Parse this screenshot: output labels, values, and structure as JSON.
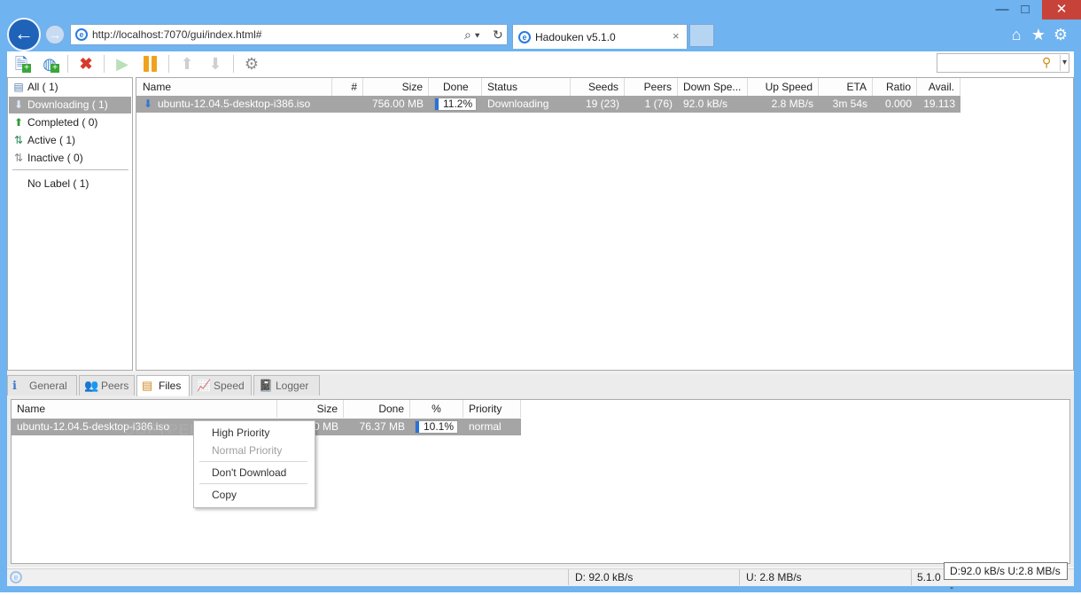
{
  "browser": {
    "address": "http://localhost:7070/gui/index.html#",
    "tab_title": "Hadouken v5.1.0",
    "tab_close": "×",
    "window_controls": {
      "minimize": "—",
      "maximize": "□",
      "close": "✕"
    }
  },
  "filters": {
    "items": [
      {
        "icon": "all-icon",
        "label": "All ( 1)"
      },
      {
        "icon": "download-arrow-icon",
        "label": "Downloading ( 1)"
      },
      {
        "icon": "upload-arrow-icon",
        "label": "Completed ( 0)"
      },
      {
        "icon": "active-arrows-icon",
        "label": "Active ( 1)"
      },
      {
        "icon": "inactive-arrows-icon",
        "label": "Inactive ( 0)"
      }
    ],
    "labels": [
      {
        "label": "No Label ( 1)"
      }
    ],
    "selected_index": 1
  },
  "torrents": {
    "columns": [
      "Name",
      "#",
      "Size",
      "Done",
      "Status",
      "Seeds",
      "Peers",
      "Down Spe...",
      "Up Speed",
      "ETA",
      "Ratio",
      "Avail."
    ],
    "rows": [
      {
        "name": "ubuntu-12.04.5-desktop-i386.iso",
        "num": "",
        "size": "756.00 MB",
        "done": "11.2%",
        "done_fraction": 0.112,
        "status": "Downloading",
        "seeds": "19 (23)",
        "peers": "1 (76)",
        "down_speed": "92.0 kB/s",
        "up_speed": "2.8 MB/s",
        "eta": "3m 54s",
        "ratio": "0.000",
        "avail": "19.113"
      }
    ]
  },
  "detail_tabs": [
    {
      "icon": "info-icon",
      "label": "General"
    },
    {
      "icon": "peers-icon",
      "label": "Peers"
    },
    {
      "icon": "files-icon",
      "label": "Files"
    },
    {
      "icon": "speed-chart-icon",
      "label": "Speed"
    },
    {
      "icon": "logger-icon",
      "label": "Logger"
    }
  ],
  "files": {
    "columns": [
      "Name",
      "Size",
      "Done",
      "%",
      "Priority"
    ],
    "rows": [
      {
        "name": "ubuntu-12.04.5-desktop-i386.iso",
        "size": "0 MB",
        "done": "76.37 MB",
        "percent": "10.1%",
        "percent_fraction": 0.101,
        "priority": "normal"
      }
    ]
  },
  "context_menu": {
    "items": [
      "High Priority",
      "Normal Priority",
      "Don't Download",
      "Copy"
    ]
  },
  "statusbar": {
    "down": "D: 92.0 kB/s",
    "up": "U: 2.8 MB/s",
    "version": "5.1.0",
    "tooltip": "D:92.0 kB/s U:2.8 MB/s -"
  }
}
